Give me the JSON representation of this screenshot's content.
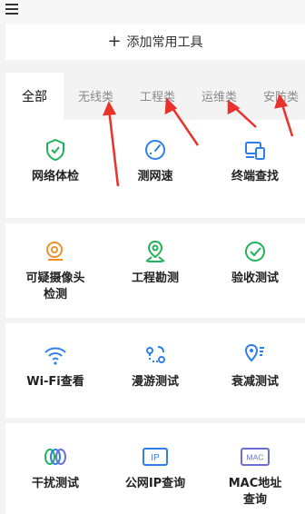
{
  "header": {
    "add_label": "添加常用工具",
    "plus_glyph": "+"
  },
  "tabs": [
    {
      "label": "全部",
      "active": true
    },
    {
      "label": "无线类"
    },
    {
      "label": "工程类"
    },
    {
      "label": "运维类"
    },
    {
      "label": "安防类"
    }
  ],
  "tools": [
    {
      "label": "网络体检",
      "icon": "shield-check-icon",
      "color": "#20b25a"
    },
    {
      "label": "测网速",
      "icon": "speedometer-icon",
      "color": "#2f7fe8"
    },
    {
      "label": "终端查找",
      "icon": "devices-icon",
      "color": "#2f7fe8"
    },
    {
      "label": "可疑摄像头\n检测",
      "icon": "camera-icon",
      "color": "#f0902a"
    },
    {
      "label": "工程勘测",
      "icon": "map-pin-icon",
      "color": "#20b25a"
    },
    {
      "label": "验收测试",
      "icon": "check-circle-icon",
      "color": "#20b25a"
    },
    {
      "label": "Wi-Fi查看",
      "icon": "wifi-icon",
      "color": "#2f7fe8"
    },
    {
      "label": "漫游测试",
      "icon": "roaming-icon",
      "color": "#2f7fe8"
    },
    {
      "label": "衰减测试",
      "icon": "signal-pin-icon",
      "color": "#2f7fe8"
    },
    {
      "label": "干扰测试",
      "icon": "rings-icon",
      "color": "#20b25a"
    },
    {
      "label": "公网IP查询",
      "icon": "ip-icon",
      "color": "#2f7fe8",
      "badge": "IP"
    },
    {
      "label": "MAC地址\n查询",
      "icon": "mac-icon",
      "color": "#6a6fd8",
      "badge": "MAC"
    }
  ],
  "annotation_color": "#e8322b"
}
